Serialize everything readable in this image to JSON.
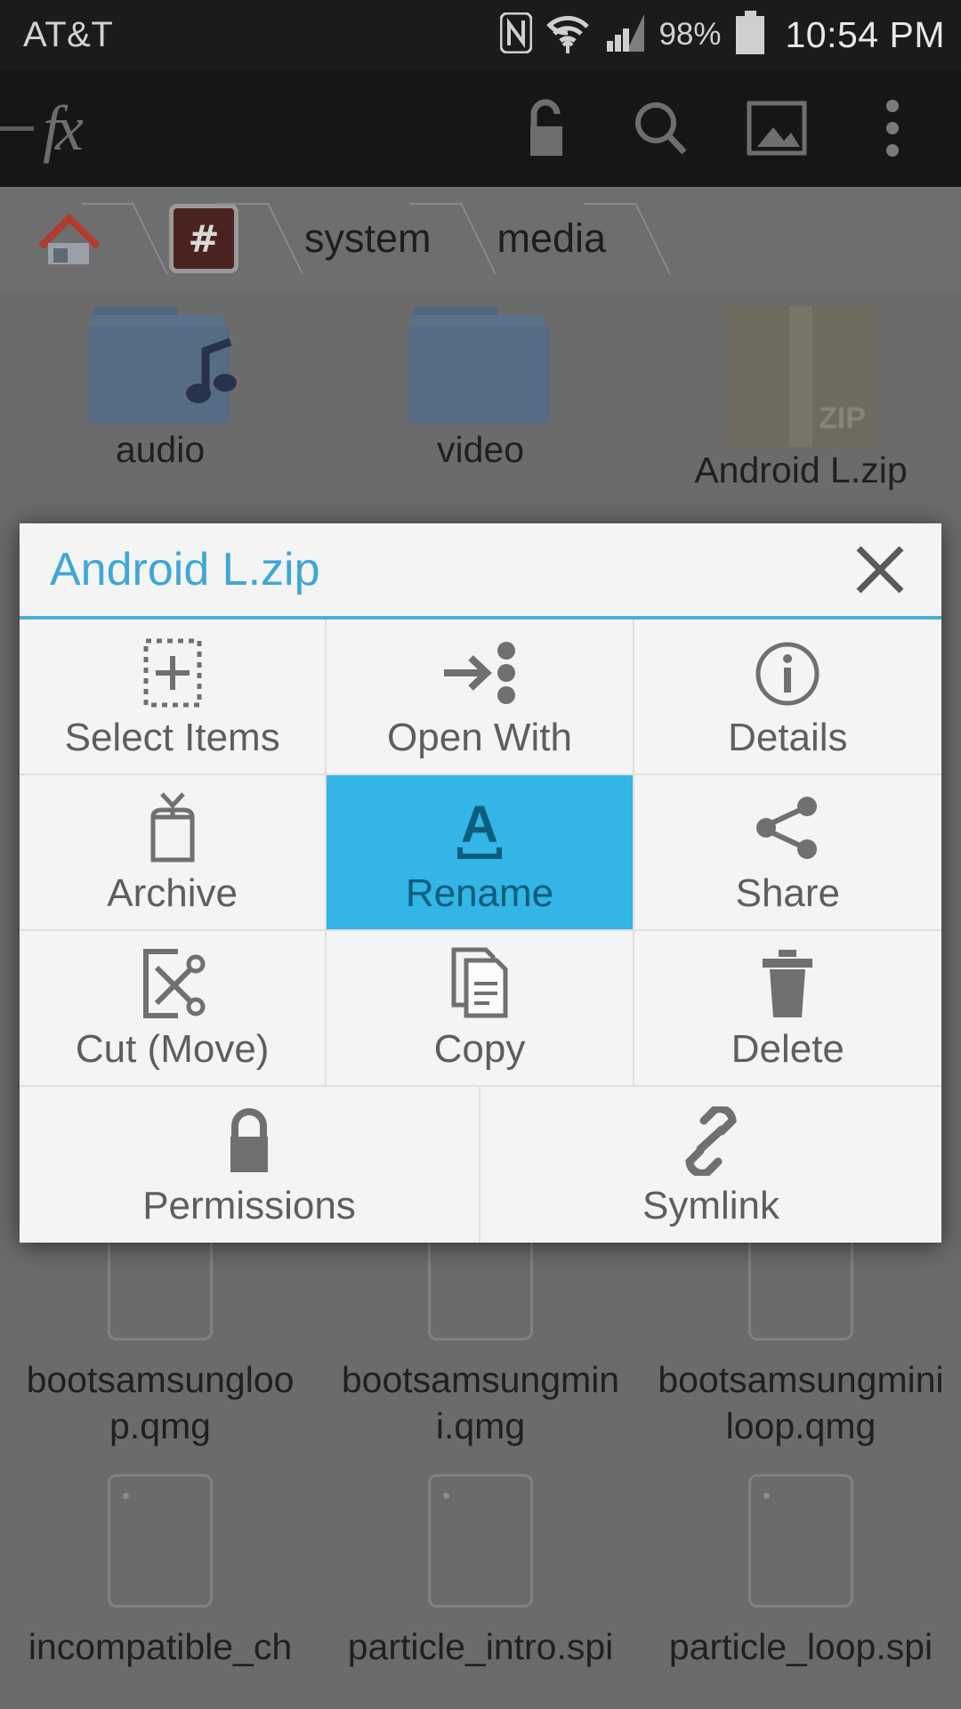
{
  "status_bar": {
    "carrier": "AT&T",
    "battery_percent": "98%",
    "time": "10:54 PM",
    "icons": [
      "nfc-icon",
      "wifi-icon",
      "cellular-signal-icon",
      "battery-icon"
    ]
  },
  "toolbar": {
    "app_logo": "fx",
    "actions": [
      {
        "name": "unlock-icon",
        "label": "Unlock"
      },
      {
        "name": "search-icon",
        "label": "Search"
      },
      {
        "name": "image-gallery-icon",
        "label": "Gallery"
      },
      {
        "name": "overflow-menu-icon",
        "label": "More options"
      }
    ]
  },
  "breadcrumb": {
    "items": [
      {
        "label": "",
        "icon": "home-icon"
      },
      {
        "label": "",
        "icon": "root-hash-icon"
      },
      {
        "label": "system",
        "icon": ""
      },
      {
        "label": "media",
        "icon": ""
      }
    ]
  },
  "file_grid": {
    "rows": [
      [
        "audio",
        "video",
        "Android L.zip"
      ],
      [
        "bootsamsunglo​op.qmg",
        "bootsamsungm​ini.qmg",
        "bootsamsungm​iniloop.qmg"
      ],
      [
        "incompatible_ch",
        "particle_intro.spi",
        "particle_loop.spi"
      ]
    ]
  },
  "dialog": {
    "title": "Android L.zip",
    "close_label": "Close",
    "actions": [
      {
        "label": "Select Items",
        "icon": "select-items-icon",
        "selected": false
      },
      {
        "label": "Open With",
        "icon": "open-with-icon",
        "selected": false
      },
      {
        "label": "Details",
        "icon": "info-icon",
        "selected": false
      },
      {
        "label": "Archive",
        "icon": "archive-box-icon",
        "selected": false
      },
      {
        "label": "Rename",
        "icon": "rename-icon",
        "selected": true
      },
      {
        "label": "Share",
        "icon": "share-icon",
        "selected": false
      },
      {
        "label": "Cut (Move)",
        "icon": "cut-scissors-icon",
        "selected": false
      },
      {
        "label": "Copy",
        "icon": "copy-icon",
        "selected": false
      },
      {
        "label": "Delete",
        "icon": "trash-icon",
        "selected": false
      },
      {
        "label": "Permissions",
        "icon": "lock-icon",
        "selected": false
      },
      {
        "label": "Symlink",
        "icon": "link-chain-icon",
        "selected": false
      }
    ]
  },
  "colors": {
    "accent": "#33b5e5",
    "title_blue": "#3fa7d6",
    "dialog_bg": "#f4f4f4",
    "statusbar_bg": "#1b1b1b",
    "toolbar_bg": "#161616",
    "backdrop": "#6b6b6b"
  }
}
